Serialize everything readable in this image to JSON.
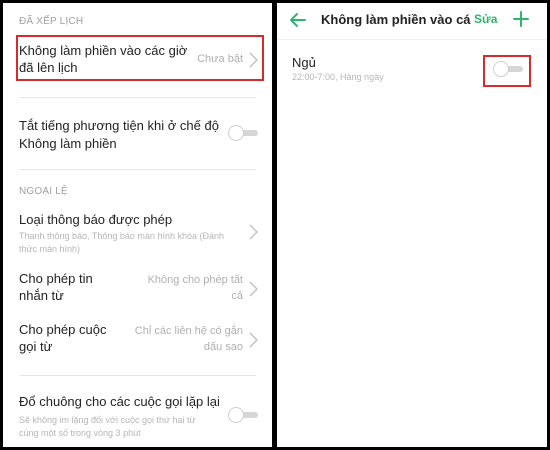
{
  "left": {
    "scheduled_header": "ĐÃ XẾP LỊCH",
    "scheduled_item": {
      "title_line1": "Không làm phiền vào các giờ",
      "title_line2": "đã lên lịch",
      "value": "Chưa bật"
    },
    "mute_media": {
      "title_line1": "Tắt tiếng phương tiện khi ở chế độ",
      "title_line2": "Không làm phiền",
      "toggle_on": false
    },
    "exceptions_header": "NGOẠI LỆ",
    "allowed_notifications": {
      "title": "Loại thông báo được phép",
      "sub_line1": "Thanh thông báo, Thông báo màn hình khóa (Đánh",
      "sub_line2": "thức màn hình)"
    },
    "allow_messages": {
      "title_line1": "Cho phép tin",
      "title_line2": "nhắn từ",
      "value_line1": "Không cho phép tất",
      "value_line2": "cả"
    },
    "allow_calls": {
      "title_line1": "Cho phép cuộc",
      "title_line2": "gọi từ",
      "value_line1": "Chỉ các liên hệ có gắn",
      "value_line2": "dấu sao"
    },
    "repeat_calls": {
      "title": "Đổ chuông cho các cuộc gọi lặp lại",
      "sub_line1": "Sẽ không im lặng đối với cuộc gọi thứ hai từ",
      "sub_line2": "cùng một số trong vòng 3 phút",
      "toggle_on": false
    }
  },
  "right": {
    "title": "Không làm phiền vào cá...",
    "edit_label": "Sửa",
    "schedule_item": {
      "name": "Ngủ",
      "detail": "22:00-7:00, Hàng ngày",
      "toggle_on": false
    }
  },
  "colors": {
    "accent": "#2fb56d",
    "highlight": "#d72a2a"
  }
}
